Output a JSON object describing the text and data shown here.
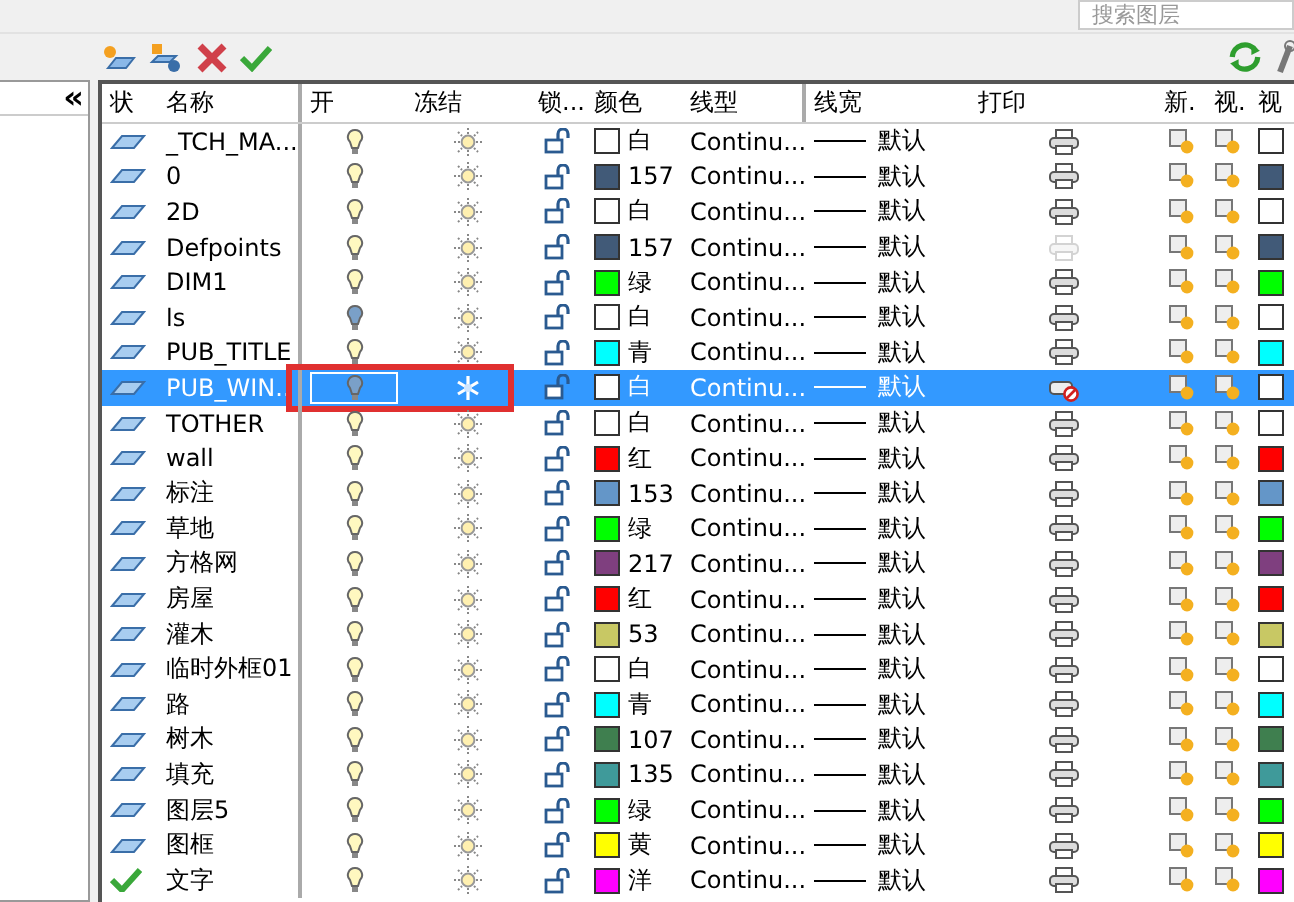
{
  "search": {
    "placeholder": "搜索图层"
  },
  "columns": [
    "状",
    "名称",
    "开",
    "冻结",
    "锁...",
    "颜色",
    "线型",
    "线宽",
    "打印",
    "新.",
    "视.",
    "视"
  ],
  "layers": [
    {
      "current": false,
      "name": "_TCH_MA...",
      "on": true,
      "frozen": false,
      "color": "#ffffff",
      "color_label": "白",
      "linetype": "Continu...",
      "lineweight": "默认",
      "plot": true,
      "greyed": false,
      "selected": false,
      "annotated": false
    },
    {
      "current": false,
      "name": "0",
      "on": true,
      "frozen": false,
      "color": "#415a78",
      "color_label": "157",
      "linetype": "Continu...",
      "lineweight": "默认",
      "plot": true,
      "greyed": false,
      "selected": false,
      "annotated": false
    },
    {
      "current": false,
      "name": "2D",
      "on": true,
      "frozen": false,
      "color": "#ffffff",
      "color_label": "白",
      "linetype": "Continu...",
      "lineweight": "默认",
      "plot": true,
      "greyed": false,
      "selected": false,
      "annotated": false
    },
    {
      "current": false,
      "name": "Defpoints",
      "on": true,
      "frozen": false,
      "color": "#415a78",
      "color_label": "157",
      "linetype": "Continu...",
      "lineweight": "默认",
      "plot": true,
      "greyed": true,
      "selected": false,
      "annotated": false
    },
    {
      "current": false,
      "name": "DIM1",
      "on": true,
      "frozen": false,
      "color": "#00ff00",
      "color_label": "绿",
      "linetype": "Continu...",
      "lineweight": "默认",
      "plot": true,
      "greyed": false,
      "selected": false,
      "annotated": false
    },
    {
      "current": false,
      "name": "ls",
      "on": false,
      "frozen": false,
      "color": "#ffffff",
      "color_label": "白",
      "linetype": "Continu...",
      "lineweight": "默认",
      "plot": true,
      "greyed": false,
      "selected": false,
      "annotated": false
    },
    {
      "current": false,
      "name": "PUB_TITLE",
      "on": true,
      "frozen": false,
      "color": "#00ffff",
      "color_label": "青",
      "linetype": "Continu...",
      "lineweight": "默认",
      "plot": true,
      "greyed": false,
      "selected": false,
      "annotated": false
    },
    {
      "current": false,
      "name": "PUB_WIN..",
      "on": false,
      "frozen": true,
      "color": "#ffffff",
      "color_label": "白",
      "linetype": "Continu...",
      "lineweight": "默认",
      "plot": false,
      "greyed": false,
      "selected": true,
      "annotated": true
    },
    {
      "current": false,
      "name": "TOTHER",
      "on": true,
      "frozen": false,
      "color": "#ffffff",
      "color_label": "白",
      "linetype": "Continu...",
      "lineweight": "默认",
      "plot": true,
      "greyed": false,
      "selected": false,
      "annotated": false
    },
    {
      "current": false,
      "name": "wall",
      "on": true,
      "frozen": false,
      "color": "#ff0000",
      "color_label": "红",
      "linetype": "Continu...",
      "lineweight": "默认",
      "plot": true,
      "greyed": false,
      "selected": false,
      "annotated": false
    },
    {
      "current": false,
      "name": "标注",
      "on": true,
      "frozen": false,
      "color": "#6496c8",
      "color_label": "153",
      "linetype": "Continu...",
      "lineweight": "默认",
      "plot": true,
      "greyed": false,
      "selected": false,
      "annotated": false
    },
    {
      "current": false,
      "name": "草地",
      "on": true,
      "frozen": false,
      "color": "#00ff00",
      "color_label": "绿",
      "linetype": "Continu...",
      "lineweight": "默认",
      "plot": true,
      "greyed": false,
      "selected": false,
      "annotated": false
    },
    {
      "current": false,
      "name": "方格网",
      "on": true,
      "frozen": false,
      "color": "#7f3f7f",
      "color_label": "217",
      "linetype": "Continu...",
      "lineweight": "默认",
      "plot": true,
      "greyed": false,
      "selected": false,
      "annotated": false
    },
    {
      "current": false,
      "name": "房屋",
      "on": true,
      "frozen": false,
      "color": "#ff0000",
      "color_label": "红",
      "linetype": "Continu...",
      "lineweight": "默认",
      "plot": true,
      "greyed": false,
      "selected": false,
      "annotated": false
    },
    {
      "current": false,
      "name": "灌木",
      "on": true,
      "frozen": false,
      "color": "#c8c864",
      "color_label": "53",
      "linetype": "Continu...",
      "lineweight": "默认",
      "plot": true,
      "greyed": false,
      "selected": false,
      "annotated": false
    },
    {
      "current": false,
      "name": "临时外框01",
      "on": true,
      "frozen": false,
      "color": "#ffffff",
      "color_label": "白",
      "linetype": "Continu...",
      "lineweight": "默认",
      "plot": true,
      "greyed": false,
      "selected": false,
      "annotated": false
    },
    {
      "current": false,
      "name": "路",
      "on": true,
      "frozen": false,
      "color": "#00ffff",
      "color_label": "青",
      "linetype": "Continu...",
      "lineweight": "默认",
      "plot": true,
      "greyed": false,
      "selected": false,
      "annotated": false
    },
    {
      "current": false,
      "name": "树木",
      "on": true,
      "frozen": false,
      "color": "#3f7f4f",
      "color_label": "107",
      "linetype": "Continu...",
      "lineweight": "默认",
      "plot": true,
      "greyed": false,
      "selected": false,
      "annotated": false
    },
    {
      "current": false,
      "name": "填充",
      "on": true,
      "frozen": false,
      "color": "#3f9a9a",
      "color_label": "135",
      "linetype": "Continu...",
      "lineweight": "默认",
      "plot": true,
      "greyed": false,
      "selected": false,
      "annotated": false
    },
    {
      "current": false,
      "name": "图层5",
      "on": true,
      "frozen": false,
      "color": "#00ff00",
      "color_label": "绿",
      "linetype": "Continu...",
      "lineweight": "默认",
      "plot": true,
      "greyed": false,
      "selected": false,
      "annotated": false
    },
    {
      "current": false,
      "name": "图框",
      "on": true,
      "frozen": false,
      "color": "#ffff00",
      "color_label": "黄",
      "linetype": "Continu...",
      "lineweight": "默认",
      "plot": true,
      "greyed": false,
      "selected": false,
      "annotated": false
    },
    {
      "current": true,
      "name": "文字",
      "on": true,
      "frozen": false,
      "color": "#ff00ff",
      "color_label": "洋",
      "linetype": "Continu...",
      "lineweight": "默认",
      "plot": true,
      "greyed": false,
      "selected": false,
      "annotated": false
    }
  ],
  "collapse_button": "«"
}
